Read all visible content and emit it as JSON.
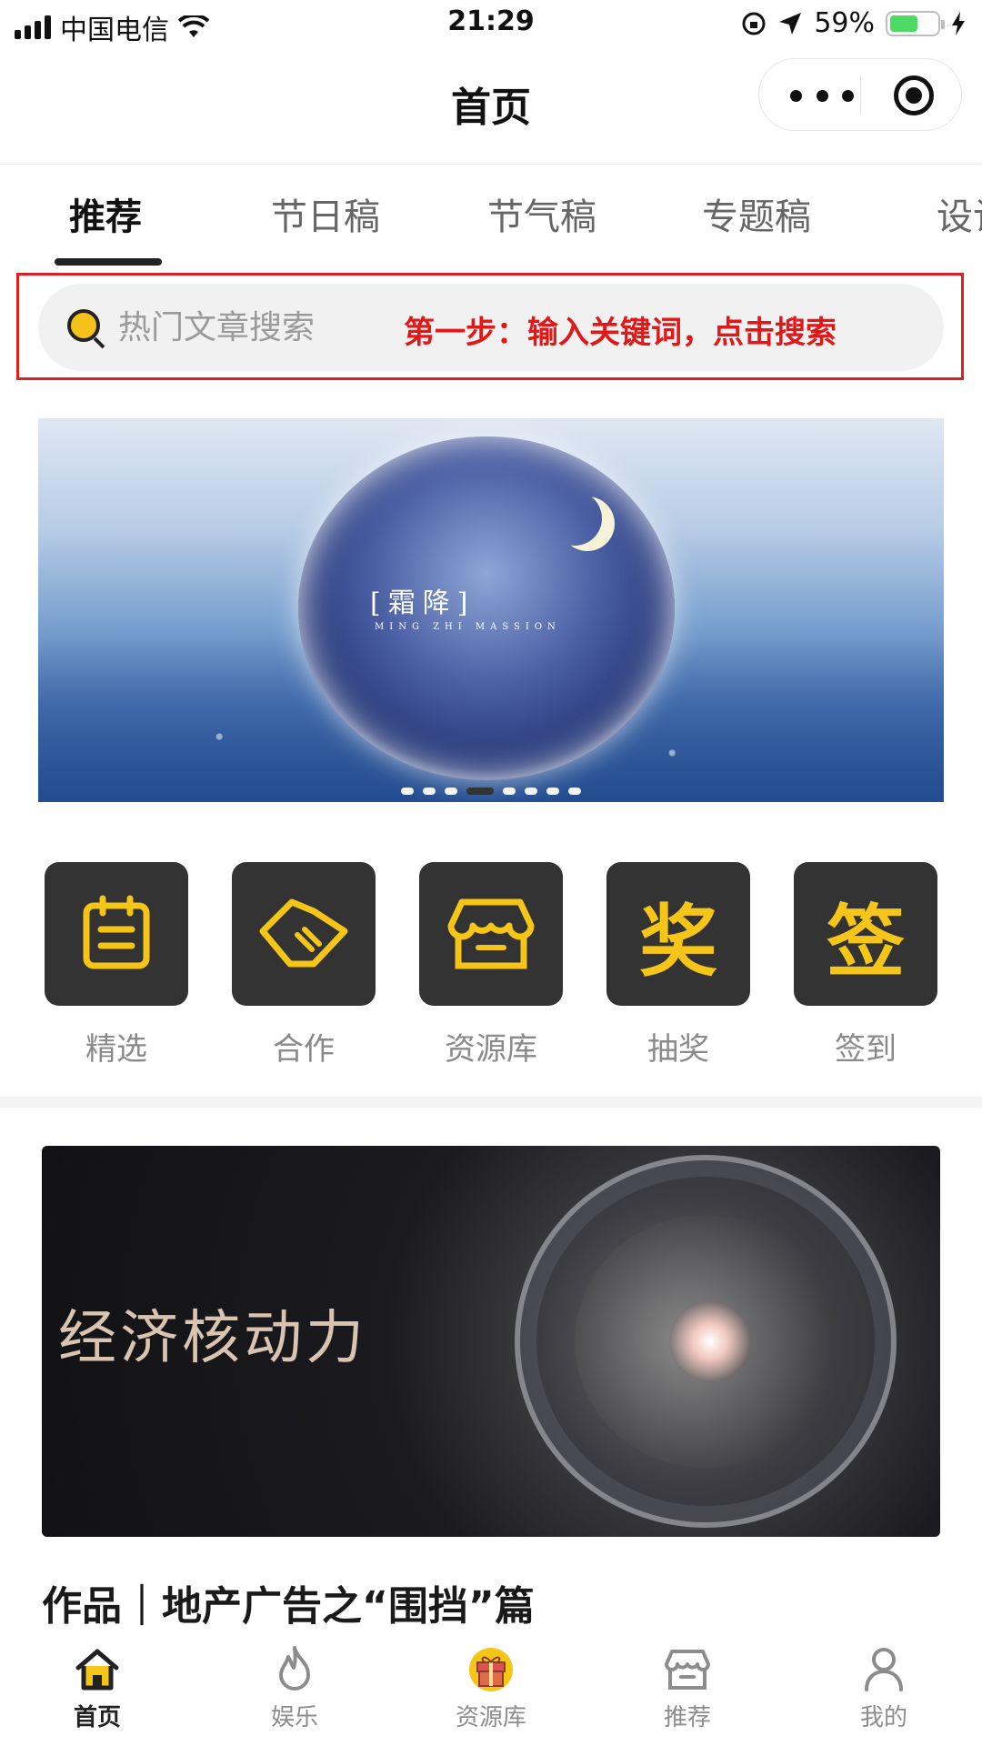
{
  "status_bar": {
    "carrier": "中国电信",
    "time": "21:29",
    "battery_percent": "59%",
    "battery_level": 0.59
  },
  "nav": {
    "title": "首页"
  },
  "tabs": [
    {
      "label": "推荐",
      "active": true
    },
    {
      "label": "节日稿"
    },
    {
      "label": "节气稿"
    },
    {
      "label": "专题稿"
    },
    {
      "label": "设计"
    }
  ],
  "search": {
    "placeholder": "热门文章搜索",
    "hint": "第一步：输入关键词，点击搜索"
  },
  "banner": {
    "title": "[霜降]",
    "subtitle": "MING ZHI MASSION",
    "slide_count": 8,
    "active_slide": 4
  },
  "grid": [
    {
      "label": "精选",
      "icon": "calendar-icon"
    },
    {
      "label": "合作",
      "icon": "handshake-icon"
    },
    {
      "label": "资源库",
      "icon": "store-icon"
    },
    {
      "label": "抽奖",
      "icon_text": "奖"
    },
    {
      "label": "签到",
      "icon_text": "签"
    }
  ],
  "article": {
    "image_headline": "经济核动力",
    "title": "作品｜地产广告之“围挡”篇"
  },
  "tabbar": [
    {
      "label": "首页",
      "icon": "home-icon",
      "active": true
    },
    {
      "label": "娱乐",
      "icon": "flame-icon"
    },
    {
      "label": "资源库",
      "icon": "gift-icon"
    },
    {
      "label": "推荐",
      "icon": "store-icon"
    },
    {
      "label": "我的",
      "icon": "user-icon"
    }
  ],
  "colors": {
    "accent": "#f5c518",
    "highlight_red": "#e01818",
    "icon_tile": "#333333"
  }
}
